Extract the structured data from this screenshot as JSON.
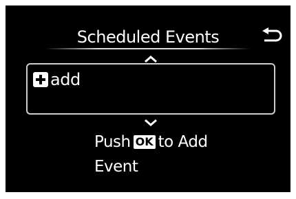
{
  "header": {
    "title": "Scheduled Events"
  },
  "list": {
    "items": [
      {
        "label": "add",
        "icon": "plus-icon"
      }
    ]
  },
  "hint": {
    "line1_prefix": "Push",
    "ok_label": "OK",
    "line1_suffix": "to Add",
    "line2": "Event"
  },
  "icons": {
    "back": "back-arrow-icon",
    "scroll_up": "chevron-up-icon",
    "scroll_down": "chevron-down-icon"
  },
  "colors": {
    "background": "#000000",
    "text": "#ffffff",
    "border": "#cfcfcf"
  }
}
